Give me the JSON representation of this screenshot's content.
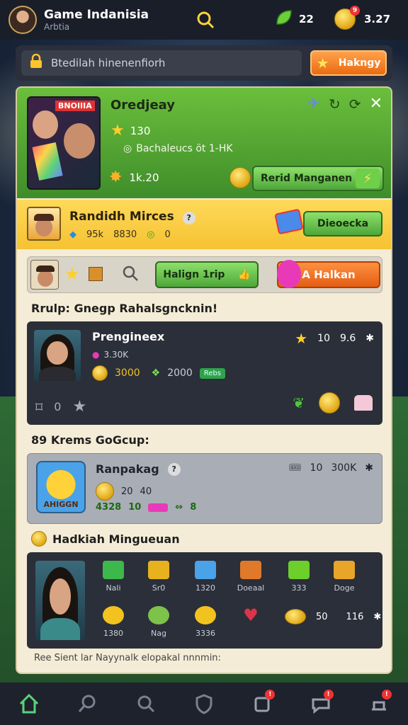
{
  "topbar": {
    "title": "Game Indanisia",
    "subtitle": "Arbtia",
    "leaf_count": "22",
    "coin_count": "3.27",
    "coin_badge": "9"
  },
  "searchbar": {
    "placeholder": "Btedilah hinenenfiorh",
    "button_label": "Hakngy"
  },
  "hero": {
    "tag": "BNOIIIA",
    "name": "Oredjeay",
    "rating": "130",
    "description": "Bachaleucs öt 1-HK",
    "time": "1k.20",
    "button_label": "Rerid Manganen"
  },
  "gold_row": {
    "name": "Randidh Mirces",
    "stat1": "95k",
    "stat2": "8830",
    "stat3": "0",
    "button_label": "Dieoecka"
  },
  "action_row": {
    "button_label": "Halign 1rip",
    "orange_label": "A Halkan"
  },
  "group_title": "Rrulp: Gnegp Rahalsgncknin!",
  "card1": {
    "name": "Prengineex",
    "views": "3.30K",
    "coins": "3000",
    "gems": "2000",
    "badge": "Rebs",
    "rating": "10",
    "score": "9.6",
    "footer_count": "0"
  },
  "section2_title": "89 Krems GoGcup:",
  "card2": {
    "name": "Ranpakag",
    "rating": "10",
    "score": "300K",
    "line1a": "20",
    "line1b": "40",
    "v1": "4328",
    "v2": "10",
    "v3": "8",
    "icon_label": "AHIGGN"
  },
  "section3_title": "Hadkiah Mingueuan",
  "grid": [
    {
      "label": "Nali",
      "color": "#3db84a"
    },
    {
      "label": "Sr0",
      "color": "#e8b21e"
    },
    {
      "label": "1320",
      "color": "#4aa2e8"
    },
    {
      "label": "Doeaal",
      "color": "#e07a2a"
    },
    {
      "label": "333",
      "color": "#6ccf2a"
    },
    {
      "label": "Doge",
      "color": "#e8a52a"
    },
    {
      "label": "1380",
      "color": "#f2c21e"
    },
    {
      "label": "Nag",
      "color": "#7dc24a"
    },
    {
      "label": "3336",
      "color": "#f2c21e"
    },
    {
      "label": "",
      "color": "#e0334a"
    }
  ],
  "grid_extra": {
    "v1": "50",
    "v2": "116"
  },
  "footer": "Ree Sient lar Nayynalk elopakal nnnmin:",
  "colors": {
    "accent_green": "#4ea63a",
    "accent_orange": "#ea6b12",
    "gold": "#f5c232"
  }
}
